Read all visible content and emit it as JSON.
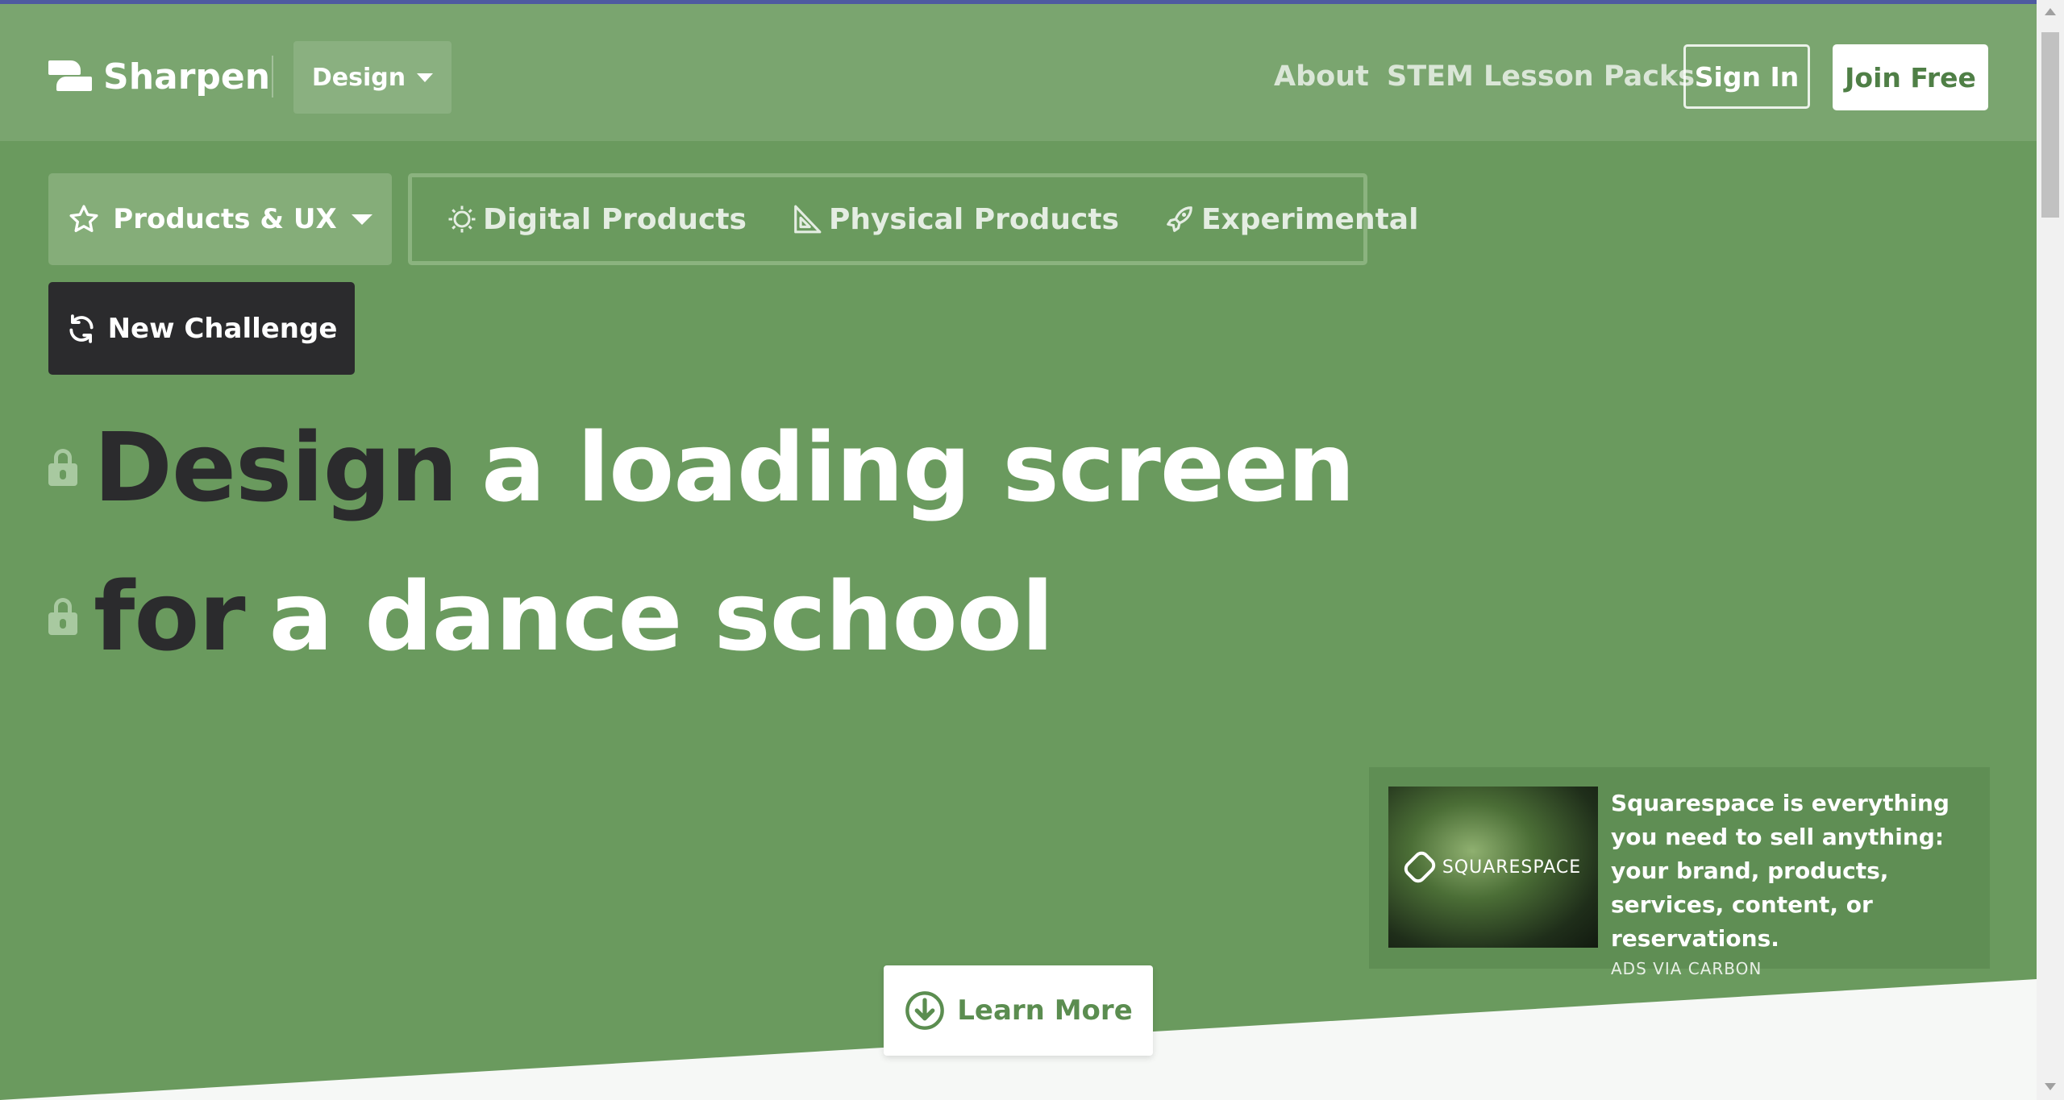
{
  "header": {
    "brand": "Sharpen",
    "category_dropdown": "Design",
    "nav": [
      "About",
      "STEM Lesson Packs"
    ],
    "sign_in": "Sign In",
    "join_free": "Join Free"
  },
  "categories": {
    "selected": "Products & UX",
    "items": [
      {
        "label": "Digital Products",
        "icon": "lightbulb-icon"
      },
      {
        "label": "Physical Products",
        "icon": "set-square-icon"
      },
      {
        "label": "Experimental",
        "icon": "rocket-icon"
      }
    ]
  },
  "new_challenge": "New Challenge",
  "headline": {
    "line1": {
      "verb": "Design",
      "rest": "a loading screen"
    },
    "line2": {
      "verb": "for",
      "rest": "a dance school"
    }
  },
  "ad": {
    "brand": "SQUARESPACE",
    "copy": "Squarespace is everything you need to sell anything: your brand, products, services, content, or reservations.",
    "via": "ADS VIA CARBON"
  },
  "learn_more": "Learn More",
  "colors": {
    "background": "#6a9a5e",
    "header": "#7aa56f",
    "dark": "#2b2b2d",
    "accent_text": "#5b8d50"
  }
}
